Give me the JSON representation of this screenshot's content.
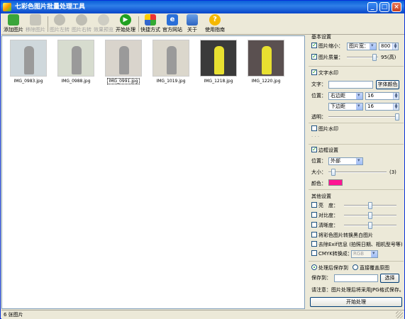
{
  "window": {
    "title": "七彩色图片批量处理工具"
  },
  "toolbar": {
    "add_image": "添加图片",
    "remove_image": "移除图片",
    "rotate_left": "图片左转",
    "rotate_right": "图片右转",
    "preview": "效果预览",
    "start": "开始处理",
    "shortcut": "快捷方式",
    "website": "官方网站",
    "about": "关于",
    "guide": "使用指南"
  },
  "gallery": {
    "items": [
      {
        "name": "IMG_0983.jpg",
        "color": "#cfd8dc"
      },
      {
        "name": "IMG_0988.jpg",
        "color": "#d7dccf"
      },
      {
        "name": "IMG_0991.jpg",
        "color": "#d9d4cc",
        "selected": true
      },
      {
        "name": "IMG_1019.jpg",
        "color": "#dbd7cc"
      },
      {
        "name": "IMG_1218.jpg",
        "color": "#3a3a3a"
      },
      {
        "name": "IMG_1220.jpg",
        "color": "#5a5050"
      }
    ]
  },
  "panel": {
    "basic": {
      "title": "基本设置",
      "resize_label": "图片缩小：",
      "resize_mode": "图片宽：",
      "resize_value": "800",
      "quality_label": "图片质量：",
      "quality_text": "95(高)",
      "quality_level": 0.95
    },
    "text_wm": {
      "title": "文字水印",
      "text_label": "文字：",
      "text_value": "",
      "font_color_btn": "字体颜色",
      "position_label": "位置：",
      "pos_h": "右边距",
      "pos_h_value": "16",
      "pos_v": "下边距",
      "pos_v_value": "16",
      "opacity_label": "透明：",
      "opacity_level": 1.0
    },
    "image_wm": {
      "title": "图片水印",
      "dots": "· · ·"
    },
    "border": {
      "title": "边框设置",
      "position_label": "位置：",
      "position_value": "外部",
      "size_label": "大小：",
      "size_text": "(3)",
      "size_level": 0.05,
      "color_label": "颜色：",
      "color": "#ff1493"
    },
    "other": {
      "title": "其他设置",
      "brightness": "亮　度：",
      "contrast": "对比度：",
      "sharpness": "清晰度：",
      "grayscale": "将彩色图片转换黑白图片",
      "exif": "去除Exif信息 (拍照日期、相机型号等)",
      "cmyk": "CMYK转换成：",
      "cmyk_value": "RGB"
    },
    "save": {
      "opt_save": "处理后保存到",
      "opt_overwrite": "直接覆盖原图",
      "save_to_label": "保存到：",
      "save_to_value": "",
      "browse": "选择",
      "note": "请注意：图片处理后将采用JPG格式保存。"
    },
    "start_btn": "开始处理"
  },
  "status": {
    "text": "6 张图片"
  }
}
